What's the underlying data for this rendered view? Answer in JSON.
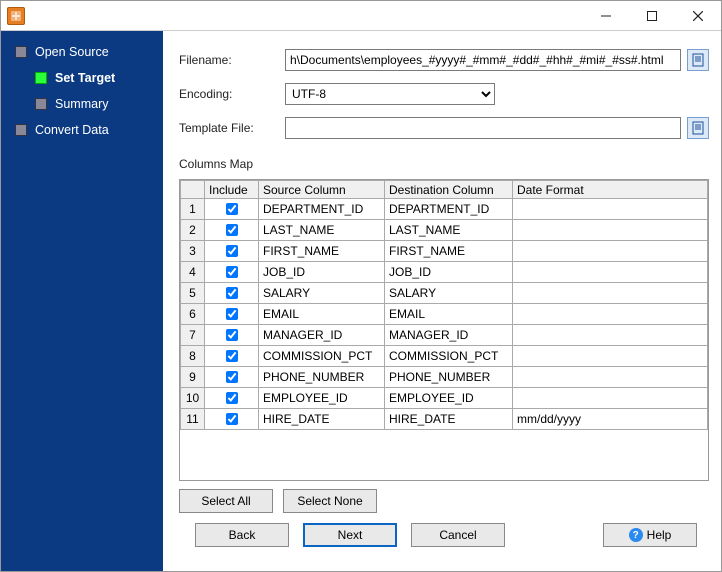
{
  "sidebar": {
    "items": [
      {
        "label": "Open Source",
        "indent": 0,
        "active": false
      },
      {
        "label": "Set Target",
        "indent": 1,
        "active": true
      },
      {
        "label": "Summary",
        "indent": 1,
        "active": false
      },
      {
        "label": "Convert Data",
        "indent": 0,
        "active": false
      }
    ]
  },
  "form": {
    "filename_label": "Filename:",
    "filename_value": "h\\Documents\\employees_#yyyy#_#mm#_#dd#_#hh#_#mi#_#ss#.html",
    "encoding_label": "Encoding:",
    "encoding_value": "UTF-8",
    "template_label": "Template File:",
    "template_value": ""
  },
  "columns_map": {
    "title": "Columns Map",
    "headers": {
      "include": "Include",
      "source": "Source Column",
      "dest": "Destination Column",
      "fmt": "Date Format"
    },
    "rows": [
      {
        "n": "1",
        "inc": true,
        "src": "DEPARTMENT_ID",
        "dst": "DEPARTMENT_ID",
        "fmt": ""
      },
      {
        "n": "2",
        "inc": true,
        "src": "LAST_NAME",
        "dst": "LAST_NAME",
        "fmt": ""
      },
      {
        "n": "3",
        "inc": true,
        "src": "FIRST_NAME",
        "dst": "FIRST_NAME",
        "fmt": ""
      },
      {
        "n": "4",
        "inc": true,
        "src": "JOB_ID",
        "dst": "JOB_ID",
        "fmt": ""
      },
      {
        "n": "5",
        "inc": true,
        "src": "SALARY",
        "dst": "SALARY",
        "fmt": ""
      },
      {
        "n": "6",
        "inc": true,
        "src": "EMAIL",
        "dst": "EMAIL",
        "fmt": ""
      },
      {
        "n": "7",
        "inc": true,
        "src": "MANAGER_ID",
        "dst": "MANAGER_ID",
        "fmt": ""
      },
      {
        "n": "8",
        "inc": true,
        "src": "COMMISSION_PCT",
        "dst": "COMMISSION_PCT",
        "fmt": ""
      },
      {
        "n": "9",
        "inc": true,
        "src": "PHONE_NUMBER",
        "dst": "PHONE_NUMBER",
        "fmt": ""
      },
      {
        "n": "10",
        "inc": true,
        "src": "EMPLOYEE_ID",
        "dst": "EMPLOYEE_ID",
        "fmt": ""
      },
      {
        "n": "11",
        "inc": true,
        "src": "HIRE_DATE",
        "dst": "HIRE_DATE",
        "fmt": "mm/dd/yyyy"
      }
    ]
  },
  "buttons": {
    "select_all": "Select All",
    "select_none": "Select None",
    "back": "Back",
    "next": "Next",
    "cancel": "Cancel",
    "help": "Help"
  }
}
